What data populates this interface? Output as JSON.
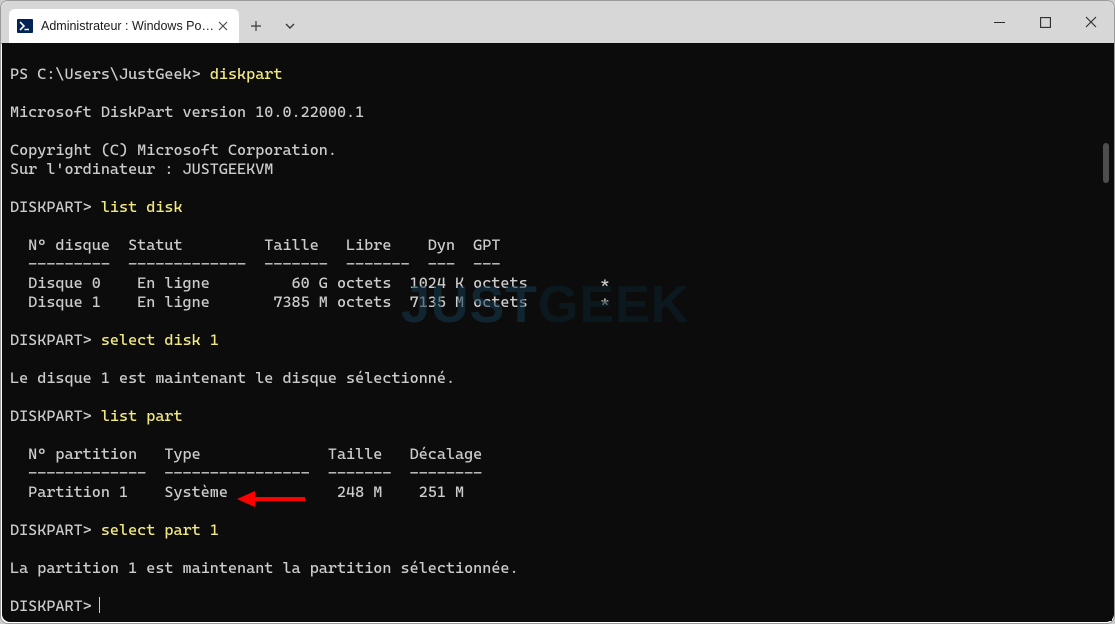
{
  "window": {
    "tab_title": "Administrateur : Windows Powe"
  },
  "t": {
    "prompt1_pre": "PS C:\\Users\\JustGeek> ",
    "cmd1": "diskpart",
    "l1": "Microsoft DiskPart version 10.0.22000.1",
    "l2": "Copyright (C) Microsoft Corporation.",
    "l3": "Sur l'ordinateur : JUSTGEEKVM",
    "prompt2_pre": "DISKPART> ",
    "cmd2": "list disk",
    "dh": "  N° disque  Statut         Taille   Libre    Dyn  GPT",
    "ds": "  ---------  -------------  -------  -------  ---  ---",
    "d0": "  Disque 0    En ligne         60 G octets  1024 K octets        *",
    "d1": "  Disque 1    En ligne       7385 M octets  7135 M octets        *",
    "prompt3_pre": "DISKPART> ",
    "cmd3": "select disk 1",
    "l4": "Le disque 1 est maintenant le disque sélectionné.",
    "prompt4_pre": "DISKPART> ",
    "cmd4": "list part",
    "ph": "  N° partition   Type              Taille   Décalage",
    "ps": "  -------------  ----------------  -------  --------",
    "p1": "  Partition 1    Système            248 M    251 M",
    "prompt5_pre": "DISKPART> ",
    "cmd5": "select part 1",
    "l5": "La partition 1 est maintenant la partition sélectionnée.",
    "prompt6_pre": "DISKPART> "
  },
  "watermark": {
    "a": "JUST",
    "b": "GEEK"
  }
}
